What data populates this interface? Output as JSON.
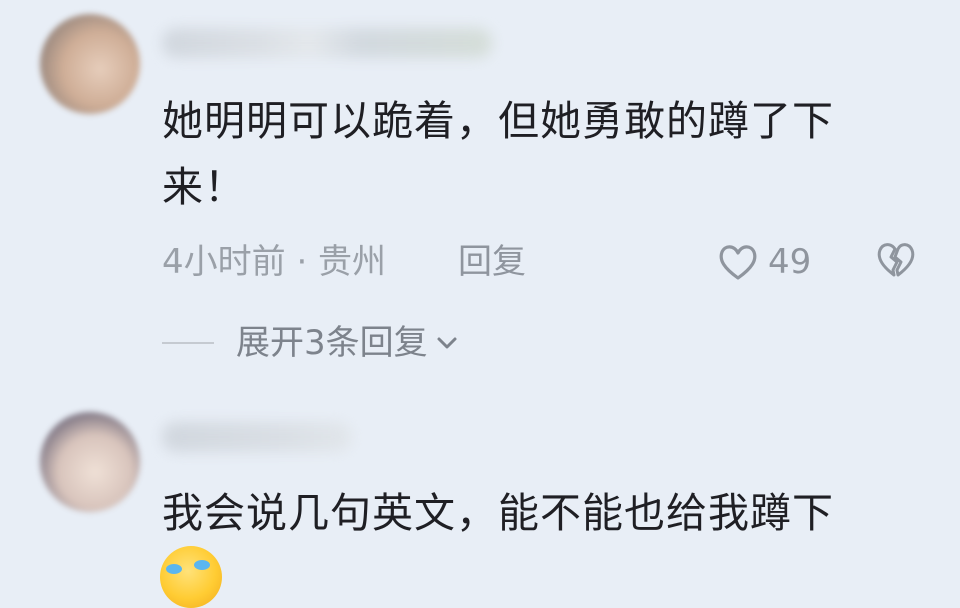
{
  "comments": [
    {
      "text_line1": "她明明可以跪着，但她勇敢的蹲了下",
      "text_line2": "来！",
      "meta": "4小时前 · 贵州",
      "reply_label": "回复",
      "likes": "49",
      "expand_label": "展开3条回复"
    },
    {
      "text_line1": "我会说几句英文，能不能也给我蹲下"
    }
  ],
  "icons": {
    "like": "heart-outline-icon",
    "dislike": "broken-heart-icon",
    "expand": "chevron-down-icon",
    "emoji": "crying-laughing-emoji"
  },
  "colors": {
    "background": "#e8eef6",
    "text": "#1f1f24",
    "meta": "#9aa0a8"
  }
}
